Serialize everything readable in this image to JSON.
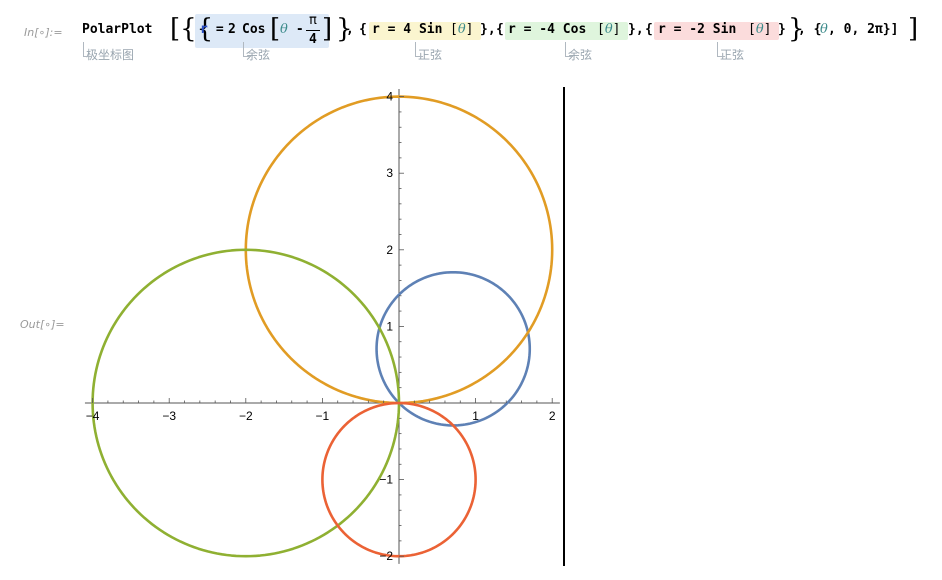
{
  "cell": {
    "in_label": "In[∘]:=",
    "out_label": "Out[∘]="
  },
  "code": {
    "func": "PolarPlot",
    "open_brackets": "[{{",
    "expr1_r": "r",
    "expr1_eq": " = ",
    "expr1_coef": "2",
    "expr1_fn": "Cos",
    "expr1_arg_var": "θ",
    "expr1_arg_minus": " - ",
    "expr1_pi": "π",
    "expr1_den": "4",
    "sep1": "}, {",
    "expr2": "r = 4 Sin",
    "sep2": "}, {",
    "expr3": "r = -4 Cos",
    "sep3": "}, {",
    "expr4": "r = -2 Sin",
    "close": "}}, {",
    "theta": "θ",
    "range": ", 0, 2π}]"
  },
  "hints": {
    "h1": "极坐标图",
    "h2": "余弦",
    "h3": "正弦",
    "h4": "余弦",
    "h5": "正弦"
  },
  "chart_data": {
    "type": "line",
    "subtype": "polar",
    "theta_range": [
      0,
      6.283185
    ],
    "series": [
      {
        "formula": "r = 2 Cos[θ - π/4]",
        "color": "#5e81b5"
      },
      {
        "formula": "r = 4 Sin[θ]",
        "color": "#e19c24"
      },
      {
        "formula": "r = -4 Cos[θ]",
        "color": "#8fb032"
      },
      {
        "formula": "r = -2 Sin[θ]",
        "color": "#eb6235"
      }
    ],
    "xlim": [
      -4.1,
      2.1
    ],
    "ylim": [
      -2.1,
      4.1
    ],
    "x_ticks": [
      "-4",
      "-3",
      "-2",
      "-1",
      "1",
      "2"
    ],
    "y_ticks": [
      "-2",
      "-1",
      "1",
      "2",
      "3",
      "4"
    ],
    "grid": false
  }
}
